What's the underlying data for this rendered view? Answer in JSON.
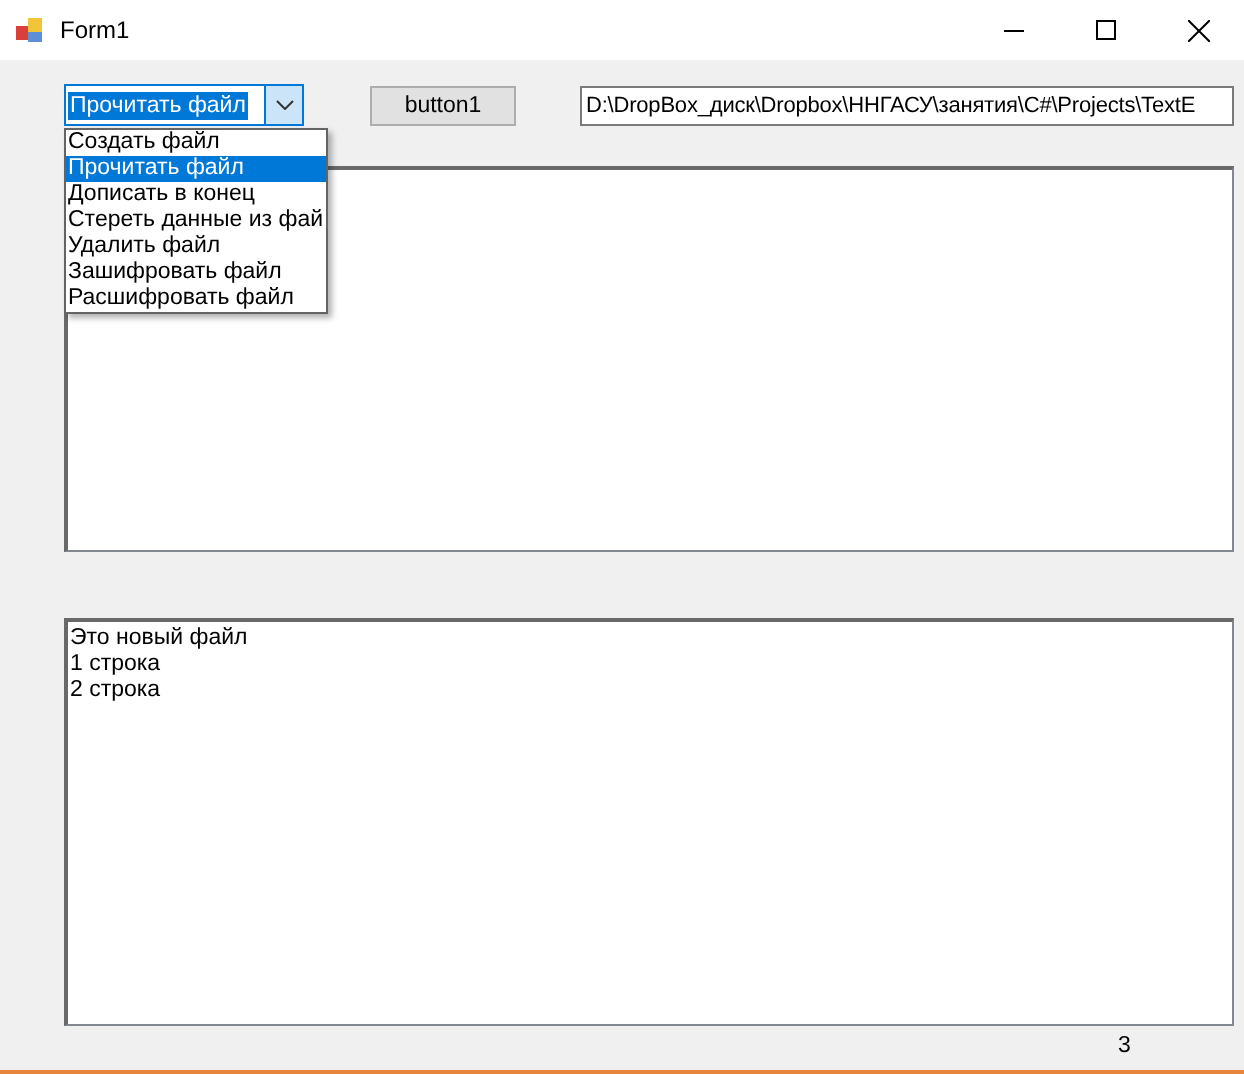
{
  "window": {
    "title": "Form1"
  },
  "combo": {
    "value": "Прочитать файл",
    "expanded": true,
    "items": [
      {
        "label": "Создать файл",
        "selected": false
      },
      {
        "label": "Прочитать файл",
        "selected": true
      },
      {
        "label": "Дописать в конец",
        "selected": false
      },
      {
        "label": "Стереть данные из фай",
        "selected": false
      },
      {
        "label": "Удалить файл",
        "selected": false
      },
      {
        "label": "Зашифровать файл",
        "selected": false
      },
      {
        "label": "Расшифровать файл",
        "selected": false
      }
    ]
  },
  "button": {
    "label": "button1"
  },
  "path_field": {
    "value": "D:\\DropBox_диск\\Dropbox\\ННГАСУ\\занятия\\C#\\Projects\\TextE"
  },
  "output_box": {
    "lines": [
      "Это новый файл",
      "1 строка",
      "2 строка"
    ]
  },
  "status_label": "3"
}
